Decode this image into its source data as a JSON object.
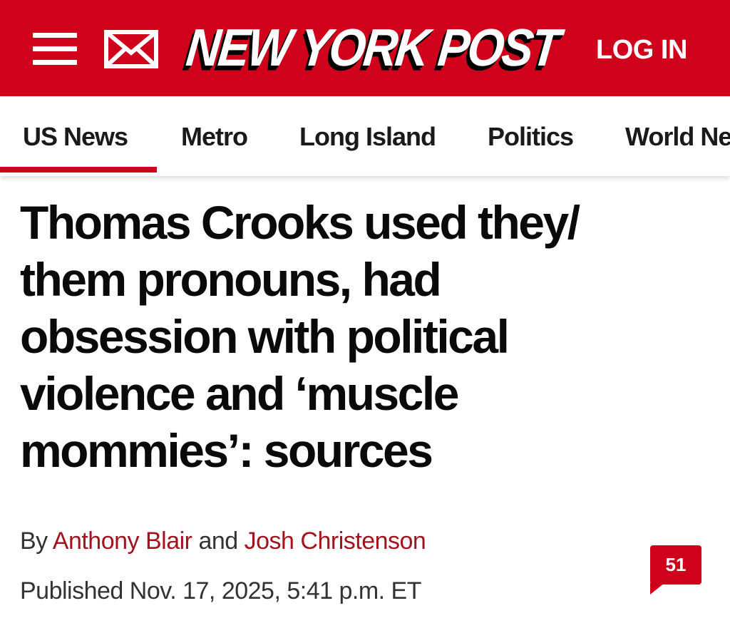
{
  "header": {
    "logo_text": "NEW YORK POST",
    "login_label": "LOG IN",
    "menu_icon": "hamburger-menu-icon",
    "mail_icon": "envelope-icon",
    "brand_color": "#d0021b"
  },
  "nav": {
    "items": [
      {
        "label": "US News",
        "active": true
      },
      {
        "label": "Metro"
      },
      {
        "label": "Long Island"
      },
      {
        "label": "Politics"
      },
      {
        "label": "World News"
      }
    ]
  },
  "article": {
    "headline_lines": [
      "Thomas Crooks used they/",
      "them pronouns, had",
      "obsession with political",
      "violence and ‘muscle",
      "mommies’: sources"
    ],
    "byline_prefix": "By",
    "authors": [
      "Anthony Blair",
      "Josh Christenson"
    ],
    "byline_joiner": "and",
    "published": "Published Nov. 17, 2025, 5:41 p.m. ET",
    "comment_count": "51",
    "author_link_color": "#a3121d"
  }
}
